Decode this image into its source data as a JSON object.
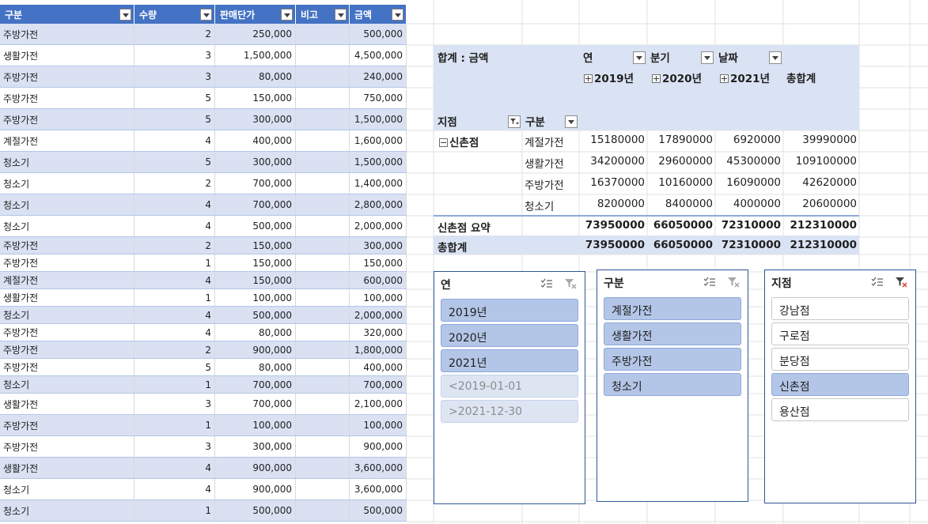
{
  "colors": {
    "header": "#4472c4",
    "band": "#d9e1f2",
    "pivot_bg": "#dae3f3",
    "slicer_selected": "#b4c6e7",
    "slicer_border": "#2f5597"
  },
  "table": {
    "headers": [
      "구분",
      "수량",
      "판매단가",
      "비고",
      "금액"
    ],
    "rows": [
      [
        "주방가전",
        "2",
        "250,000",
        "",
        "500,000"
      ],
      [
        "생활가전",
        "3",
        "1,500,000",
        "",
        "4,500,000"
      ],
      [
        "주방가전",
        "3",
        "80,000",
        "",
        "240,000"
      ],
      [
        "주방가전",
        "5",
        "150,000",
        "",
        "750,000"
      ],
      [
        "주방가전",
        "5",
        "300,000",
        "",
        "1,500,000"
      ],
      [
        "계절가전",
        "4",
        "400,000",
        "",
        "1,600,000"
      ],
      [
        "청소기",
        "5",
        "300,000",
        "",
        "1,500,000"
      ],
      [
        "청소기",
        "2",
        "700,000",
        "",
        "1,400,000"
      ],
      [
        "청소기",
        "4",
        "700,000",
        "",
        "2,800,000"
      ],
      [
        "청소기",
        "4",
        "500,000",
        "",
        "2,000,000"
      ],
      [
        "주방가전",
        "2",
        "150,000",
        "",
        "300,000"
      ],
      [
        "주방가전",
        "1",
        "150,000",
        "",
        "150,000"
      ],
      [
        "계절가전",
        "4",
        "150,000",
        "",
        "600,000"
      ],
      [
        "생활가전",
        "1",
        "100,000",
        "",
        "100,000"
      ],
      [
        "청소기",
        "4",
        "500,000",
        "",
        "2,000,000"
      ],
      [
        "주방가전",
        "4",
        "80,000",
        "",
        "320,000"
      ],
      [
        "주방가전",
        "2",
        "900,000",
        "",
        "1,800,000"
      ],
      [
        "주방가전",
        "5",
        "80,000",
        "",
        "400,000"
      ],
      [
        "청소기",
        "1",
        "700,000",
        "",
        "700,000"
      ],
      [
        "생활가전",
        "3",
        "700,000",
        "",
        "2,100,000"
      ],
      [
        "주방가전",
        "1",
        "100,000",
        "",
        "100,000"
      ],
      [
        "주방가전",
        "3",
        "300,000",
        "",
        "900,000"
      ],
      [
        "생활가전",
        "4",
        "900,000",
        "",
        "3,600,000"
      ],
      [
        "청소기",
        "4",
        "900,000",
        "",
        "3,600,000"
      ],
      [
        "청소기",
        "1",
        "500,000",
        "",
        "500,000"
      ]
    ]
  },
  "pivot": {
    "value_label": "합계 : 금액",
    "col_field_year": "연",
    "col_field_quarter": "분기",
    "col_field_date": "날짜",
    "years": [
      "2019년",
      "2020년",
      "2021년"
    ],
    "grand_total_label": "총합계",
    "row_field_branch": "지점",
    "row_field_category": "구분",
    "branch": "신촌점",
    "rows": [
      {
        "category": "계절가전",
        "values": [
          "15180000",
          "17890000",
          "6920000",
          "39990000"
        ]
      },
      {
        "category": "생활가전",
        "values": [
          "34200000",
          "29600000",
          "45300000",
          "109100000"
        ]
      },
      {
        "category": "주방가전",
        "values": [
          "16370000",
          "10160000",
          "16090000",
          "42620000"
        ]
      },
      {
        "category": "청소기",
        "values": [
          "8200000",
          "8400000",
          "4000000",
          "20600000"
        ]
      }
    ],
    "subtotal_label": "신촌점 요약",
    "subtotal_values": [
      "73950000",
      "66050000",
      "72310000",
      "212310000"
    ],
    "total_label": "총합계",
    "total_values": [
      "73950000",
      "66050000",
      "72310000",
      "212310000"
    ]
  },
  "slicers": [
    {
      "title": "연",
      "items": [
        {
          "label": "2019년",
          "state": "selected"
        },
        {
          "label": "2020년",
          "state": "selected"
        },
        {
          "label": "2021년",
          "state": "selected"
        },
        {
          "label": "<2019-01-01",
          "state": "disabled"
        },
        {
          "label": ">2021-12-30",
          "state": "disabled"
        }
      ]
    },
    {
      "title": "구분",
      "items": [
        {
          "label": "계절가전",
          "state": "selected"
        },
        {
          "label": "생활가전",
          "state": "selected"
        },
        {
          "label": "주방가전",
          "state": "selected"
        },
        {
          "label": "청소기",
          "state": "selected"
        }
      ]
    },
    {
      "title": "지점",
      "items": [
        {
          "label": "강남점",
          "state": "unselected"
        },
        {
          "label": "구로점",
          "state": "unselected"
        },
        {
          "label": "분당점",
          "state": "unselected"
        },
        {
          "label": "신촌점",
          "state": "selected"
        },
        {
          "label": "용산점",
          "state": "unselected"
        }
      ]
    }
  ],
  "icons": {
    "multi_select": "multi-select-icon",
    "clear_filter": "clear-filter-icon",
    "filter": "filter-icon"
  }
}
